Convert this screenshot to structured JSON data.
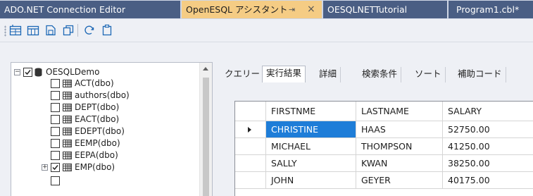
{
  "document_tabs": [
    {
      "label": "ADO.NET Connection Editor"
    },
    {
      "label": "OpenESQL アシスタント"
    },
    {
      "label": "OESQLNETTutorial"
    },
    {
      "label": "Program1.cbl*"
    }
  ],
  "active_tab_buttons": {
    "pin": "⇥",
    "close": "×"
  },
  "tree": {
    "root": "OESQLDemo",
    "nodes": [
      "ACT(dbo)",
      "authors(dbo)",
      "DEPT(dbo)",
      "EACT(dbo)",
      "EDEPT(dbo)",
      "EEMP(dbo)",
      "EEPA(dbo)",
      "EMP(dbo)"
    ]
  },
  "result_tabs": [
    "クエリー",
    "実行結果",
    "詳細",
    "検索条件",
    "ソート",
    "補助コード"
  ],
  "results": {
    "columns": [
      "FIRSTNME",
      "LASTNAME",
      "SALARY"
    ],
    "rows": [
      [
        "CHRISTINE",
        "HAAS",
        "52750.00"
      ],
      [
        "MICHAEL",
        "THOMPSON",
        "41250.00"
      ],
      [
        "SALLY",
        "KWAN",
        "38250.00"
      ],
      [
        "JOHN",
        "GEYER",
        "40175.00"
      ]
    ]
  },
  "colors": {
    "active_tab": "#f5cc84",
    "inactive_tab": "#4a5e84",
    "selection": "#1e7dd8"
  }
}
